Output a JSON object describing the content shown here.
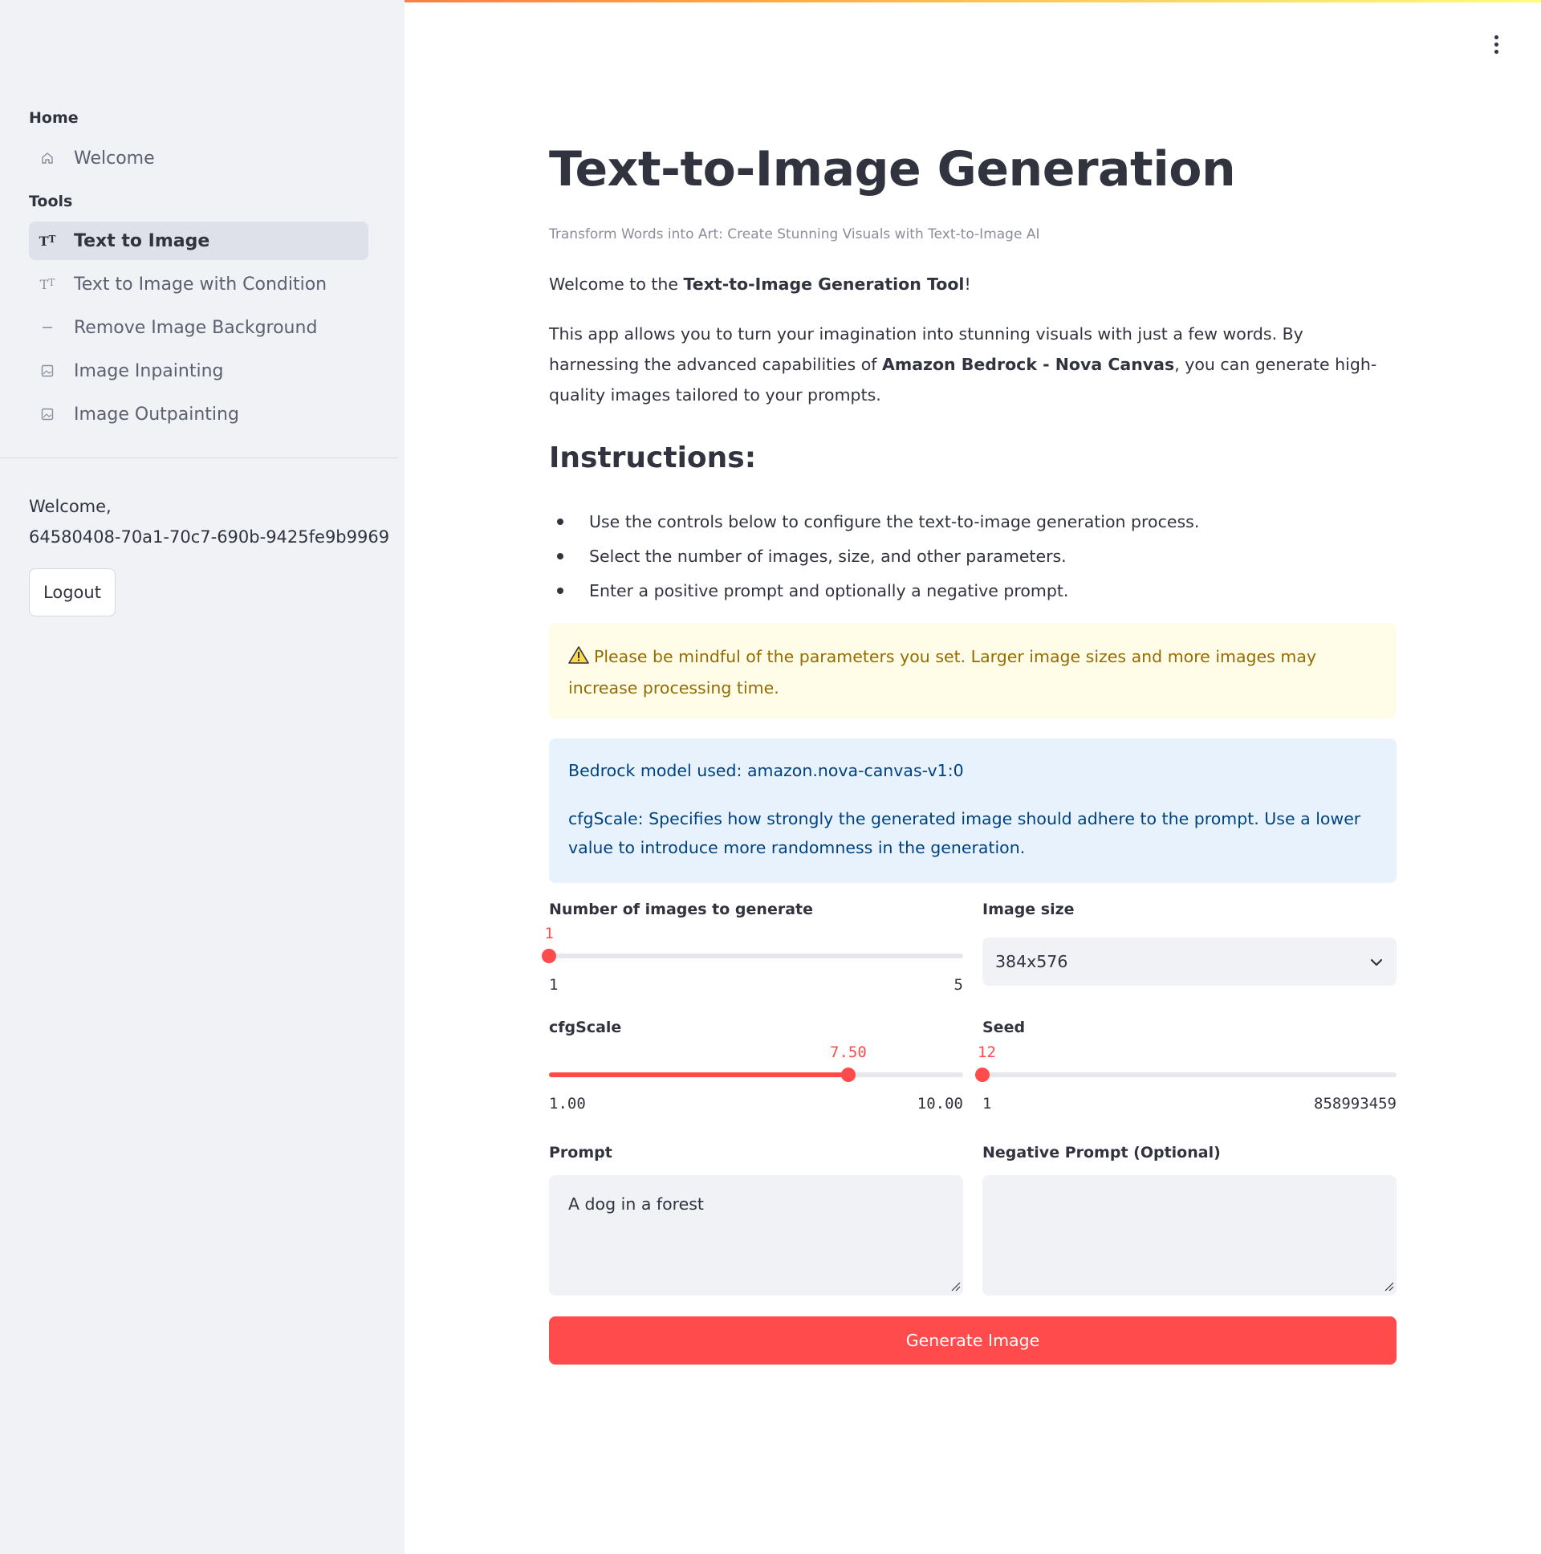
{
  "sidebar": {
    "sections": [
      {
        "label": "Home"
      },
      {
        "label": "Tools"
      }
    ],
    "items": [
      {
        "label": "Welcome",
        "icon": "home-icon"
      },
      {
        "label": "Text to Image",
        "icon": "text-size-icon",
        "active": true
      },
      {
        "label": "Text to Image with Condition",
        "icon": "text-size-icon"
      },
      {
        "label": "Remove Image Background",
        "icon": "minus-icon"
      },
      {
        "label": "Image Inpainting",
        "icon": "image-icon"
      },
      {
        "label": "Image Outpainting",
        "icon": "image-icon"
      }
    ],
    "welcome_label": "Welcome,",
    "user_id": "64580408-70a1-70c7-690b-9425fe9b9969",
    "logout_label": "Logout"
  },
  "main": {
    "title": "Text-to-Image Generation",
    "caption": "Transform Words into Art: Create Stunning Visuals with Text-to-Image AI",
    "welcome": {
      "prefix": "Welcome to the ",
      "bold": "Text-to-Image Generation Tool",
      "suffix": "!"
    },
    "intro": {
      "prefix": "This app allows you to turn your imagination into stunning visuals with just a few words. By harnessing the advanced capabilities of ",
      "bold": "Amazon Bedrock - Nova Canvas",
      "suffix": ", you can generate high-quality images tailored to your prompts."
    },
    "instructions_heading": "Instructions:",
    "instructions": [
      "Use the controls below to configure the text-to-image generation process.",
      "Select the number of images, size, and other parameters.",
      "Enter a positive prompt and optionally a negative prompt."
    ],
    "warning_text": "Please be mindful of the parameters you set. Larger image sizes and more images may increase processing time.",
    "info_model": "Bedrock model used: amazon.nova-canvas-v1:0",
    "info_cfg": "cfgScale: Specifies how strongly the generated image should adhere to the prompt. Use a lower value to introduce more randomness in the generation.",
    "generate_label": "Generate Image"
  },
  "controls": {
    "num_images": {
      "label": "Number of images to generate",
      "value": "1",
      "min": "1",
      "max": "5",
      "fraction": 0.0
    },
    "image_size": {
      "label": "Image size",
      "value": "384x576"
    },
    "cfg_scale": {
      "label": "cfgScale",
      "value": "7.50",
      "min": "1.00",
      "max": "10.00",
      "fraction": 0.7222
    },
    "seed": {
      "label": "Seed",
      "value": "12",
      "min": "1",
      "max": "858993459",
      "fraction": 0.0
    },
    "prompt": {
      "label": "Prompt",
      "value": "A dog in a forest"
    },
    "negative_prompt": {
      "label": "Negative Prompt (Optional)",
      "value": ""
    }
  },
  "colors": {
    "accent": "#ff4b4b",
    "sidebar_bg": "#f0f2f6",
    "warning_bg": "#fffce7",
    "warning_text": "#926c05",
    "info_bg": "#e8f2fc",
    "info_text": "#004280"
  }
}
